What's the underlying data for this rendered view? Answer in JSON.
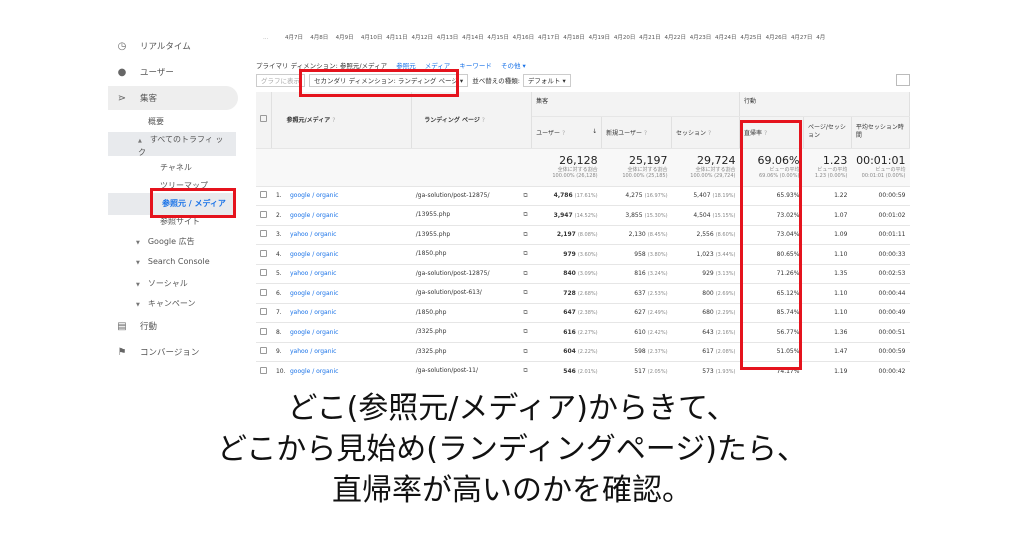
{
  "sidebar": {
    "items": [
      {
        "icon": "clock-icon",
        "label": "リアルタイム"
      },
      {
        "icon": "person-icon",
        "label": "ユーザー"
      },
      {
        "icon": "acquisition-icon",
        "label": "集客"
      },
      {
        "label": "概要"
      },
      {
        "label": "すべてのトラフィ ック"
      },
      {
        "label": "チャネル"
      },
      {
        "label": "ツリーマップ"
      },
      {
        "label": "参照元 / メディア"
      },
      {
        "label": "参照サイト"
      },
      {
        "label": "Google 広告"
      },
      {
        "label": "Search Console"
      },
      {
        "label": "ソーシャル"
      },
      {
        "label": "キャンペーン"
      },
      {
        "icon": "behavior-icon",
        "label": "行動"
      },
      {
        "icon": "flag-icon",
        "label": "コンバージョン"
      }
    ]
  },
  "dates": [
    "4月7日",
    "4月8日",
    "4月9日",
    "4月10日",
    "4月11日",
    "4月12日",
    "4月13日",
    "4月14日",
    "4月15日",
    "4月16日",
    "4月17日",
    "4月18日",
    "4月19日",
    "4月20日",
    "4月21日",
    "4月22日",
    "4月23日",
    "4月24日",
    "4月25日",
    "4月26日",
    "4月27日",
    "4月"
  ],
  "dates_lead": "...",
  "dimbar": {
    "primary": "プライマリ ディメンション: 参照元/メディア",
    "links": [
      "参照元",
      "メディア",
      "キーワード",
      "その他 ▾"
    ]
  },
  "ctrlbar": {
    "graph": "グラフに表示",
    "secondary": "セカンダリ ディメンション: ランディング ページ ▾",
    "sort_label": "並べ替えの種類:",
    "sort_value": "デフォルト ▾"
  },
  "table": {
    "group_acq": "集客",
    "group_beh": "行動",
    "col_source": "参照元/メディア",
    "col_landing": "ランディング ページ",
    "col_users": "ユーザー",
    "col_new": "新規ユーザー",
    "col_sessions": "セッション",
    "col_bounce": "直帰率",
    "col_pps": "ページ/セッション",
    "col_dur": "平均セッション時間",
    "totals": {
      "users": "26,128",
      "users_sub": "全体に対する割合",
      "users_sub2": "100.00% (26,128)",
      "new": "25,197",
      "new_sub": "全体に対する割合",
      "new_sub2": "100.00% (25,185)",
      "sessions": "29,724",
      "sessions_sub": "全体に対する割合",
      "sessions_sub2": "100.00% (29,724)",
      "bounce": "69.06%",
      "bounce_sub": "ビューの平均",
      "bounce_sub2": "69.06% (0.00%)",
      "pps": "1.23",
      "pps_sub": "ビューの平均",
      "pps_sub2": "1.23 (0.00%)",
      "dur": "00:01:01",
      "dur_sub": "ビューの平均",
      "dur_sub2": "00:01:01 (0.00%)"
    },
    "rows": [
      {
        "n": "1.",
        "src": "google / organic",
        "lp": "/ga-solution/post-12875/",
        "users": "4,786",
        "up": "(17.61%)",
        "new": "4,275",
        "np": "(16.97%)",
        "ses": "5,407",
        "sp": "(18.19%)",
        "bounce": "65.93%",
        "pps": "1.22",
        "dur": "00:00:59"
      },
      {
        "n": "2.",
        "src": "google / organic",
        "lp": "/13955.php",
        "users": "3,947",
        "up": "(14.52%)",
        "new": "3,855",
        "np": "(15.30%)",
        "ses": "4,504",
        "sp": "(15.15%)",
        "bounce": "73.02%",
        "pps": "1.07",
        "dur": "00:01:02"
      },
      {
        "n": "3.",
        "src": "yahoo / organic",
        "lp": "/13955.php",
        "users": "2,197",
        "up": "(8.08%)",
        "new": "2,130",
        "np": "(8.45%)",
        "ses": "2,556",
        "sp": "(8.60%)",
        "bounce": "73.04%",
        "pps": "1.09",
        "dur": "00:01:11"
      },
      {
        "n": "4.",
        "src": "google / organic",
        "lp": "/1850.php",
        "users": "979",
        "up": "(3.60%)",
        "new": "958",
        "np": "(3.80%)",
        "ses": "1,023",
        "sp": "(3.44%)",
        "bounce": "80.65%",
        "pps": "1.10",
        "dur": "00:00:33"
      },
      {
        "n": "5.",
        "src": "yahoo / organic",
        "lp": "/ga-solution/post-12875/",
        "users": "840",
        "up": "(3.09%)",
        "new": "816",
        "np": "(3.24%)",
        "ses": "929",
        "sp": "(3.13%)",
        "bounce": "71.26%",
        "pps": "1.35",
        "dur": "00:02:53"
      },
      {
        "n": "6.",
        "src": "google / organic",
        "lp": "/ga-solution/post-613/",
        "users": "728",
        "up": "(2.68%)",
        "new": "637",
        "np": "(2.53%)",
        "ses": "800",
        "sp": "(2.69%)",
        "bounce": "65.12%",
        "pps": "1.10",
        "dur": "00:00:44"
      },
      {
        "n": "7.",
        "src": "yahoo / organic",
        "lp": "/1850.php",
        "users": "647",
        "up": "(2.38%)",
        "new": "627",
        "np": "(2.49%)",
        "ses": "680",
        "sp": "(2.29%)",
        "bounce": "85.74%",
        "pps": "1.10",
        "dur": "00:00:49"
      },
      {
        "n": "8.",
        "src": "google / organic",
        "lp": "/3325.php",
        "users": "616",
        "up": "(2.27%)",
        "new": "610",
        "np": "(2.42%)",
        "ses": "643",
        "sp": "(2.16%)",
        "bounce": "56.77%",
        "pps": "1.36",
        "dur": "00:00:51"
      },
      {
        "n": "9.",
        "src": "yahoo / organic",
        "lp": "/3325.php",
        "users": "604",
        "up": "(2.22%)",
        "new": "598",
        "np": "(2.37%)",
        "ses": "617",
        "sp": "(2.08%)",
        "bounce": "51.05%",
        "pps": "1.47",
        "dur": "00:00:59"
      },
      {
        "n": "10.",
        "src": "google / organic",
        "lp": "/ga-solution/post-11/",
        "users": "546",
        "up": "(2.01%)",
        "new": "517",
        "np": "(2.05%)",
        "ses": "573",
        "sp": "(1.93%)",
        "bounce": "74.17%",
        "pps": "1.19",
        "dur": "00:00:42"
      }
    ]
  },
  "caption": {
    "line1": "どこ(参照元/メディア)からきて、",
    "line2": "どこから見始め(ランディングページ)たら、",
    "line3": "直帰率が高いのかを確認。"
  },
  "colors": {
    "highlight": "#e5131d",
    "link": "#1a73e8"
  }
}
